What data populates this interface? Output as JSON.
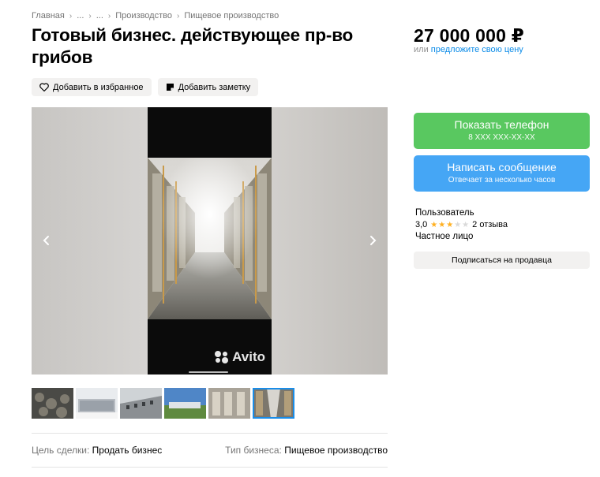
{
  "breadcrumbs": [
    "Главная",
    "...",
    "...",
    "Производство",
    "Пищевое производство"
  ],
  "title": "Готовый бизнес. действующее пр-во грибов",
  "actions": {
    "favorite": "Добавить в избранное",
    "note": "Добавить заметку"
  },
  "gallery": {
    "watermark": "Avito",
    "thumb_count": 6,
    "active_thumb": 6
  },
  "params": [
    {
      "key": "Цель сделки:",
      "value": "Продать бизнес"
    },
    {
      "key": "Тип бизнеса:",
      "value": "Пищевое производство"
    }
  ],
  "price": "27 000 000 ₽",
  "offer": {
    "prefix": "или",
    "link": "предложите свою цену"
  },
  "buttons": {
    "phone": {
      "label": "Показать телефон",
      "sub": "8 XXX XXX-XX-XX"
    },
    "message": {
      "label": "Написать сообщение",
      "sub": "Отвечает за несколько часов"
    }
  },
  "seller": {
    "name": "Пользователь",
    "rating": "3,0",
    "stars": 3,
    "reviews": "2 отзыва",
    "type": "Частное лицо"
  },
  "subscribe": "Подписаться на продавца",
  "colors": {
    "green": "#59c860",
    "blue": "#45a6f5",
    "link": "#0a8be8",
    "star": "#ffb021"
  }
}
